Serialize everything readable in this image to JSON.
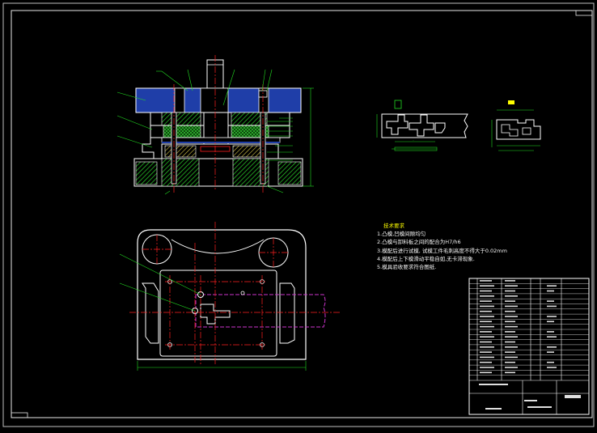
{
  "tech_requirements": {
    "title": "技术要求",
    "items": [
      "1.凸模,凹模间隙均匀",
      "2.凸模与卸料板之间的配合为H7/h6",
      "3.模配后进行试模, 试模工件毛刺高度不得大于0.02mm",
      "4.模配后上下模滑动平稳自如,无卡滞现象.",
      "5.模具验收要求符合图纸."
    ]
  },
  "colors": {
    "background": "#000000",
    "outline": "#ffffff",
    "hatch": "#2bd22b",
    "part_blue": "#1f3ea8",
    "centerline": "#ff2020",
    "leader": "#22dd22",
    "strip": "#cc33cc",
    "text": "#f4f4f4",
    "title_text": "#ffff00"
  },
  "views": [
    "front-section-view",
    "top-plan-view",
    "strip-layout-detail",
    "part-detail",
    "title-block"
  ]
}
